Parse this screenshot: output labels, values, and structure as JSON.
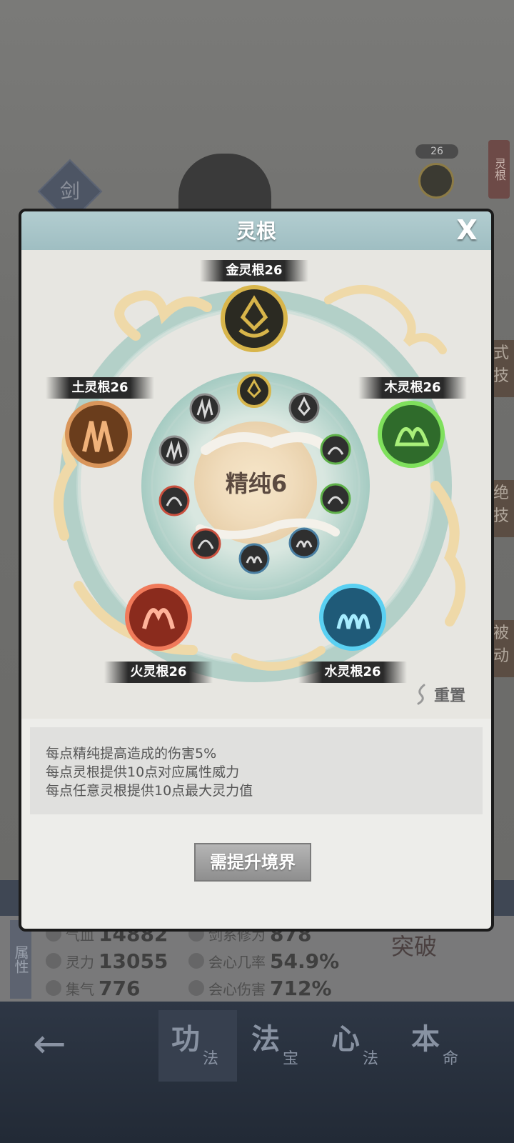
{
  "modal": {
    "title": "灵根",
    "close": "X",
    "center": "精纯6",
    "roots": {
      "metal": "金灵根26",
      "wood": "木灵根26",
      "earth": "土灵根26",
      "fire": "火灵根26",
      "water": "水灵根26"
    },
    "reset": "重置",
    "descriptions": [
      "每点精纯提高造成的伤害5%",
      "每点灵根提供10点对应属性威力",
      "每点任意灵根提供10点最大灵力值"
    ],
    "button": "需提升境界"
  },
  "background": {
    "sword_badge": "剑",
    "side_tab": "灵根",
    "mini_count": "26",
    "right_tabs": [
      "式技",
      "绝技",
      "被动"
    ]
  },
  "stats": {
    "section_label": "属性",
    "help": "?",
    "items": [
      {
        "label": "气血",
        "value": "14882"
      },
      {
        "label": "灵力",
        "value": "13055"
      },
      {
        "label": "集气",
        "value": "776"
      },
      {
        "label": "剑系修为",
        "value": "878"
      },
      {
        "label": "会心几率",
        "value": "54.9%"
      },
      {
        "label": "会心伤害",
        "value": "712%"
      }
    ],
    "breakthrough": "突破"
  },
  "nav": {
    "back": "←",
    "tabs": [
      {
        "big": "功",
        "small": "法"
      },
      {
        "big": "法",
        "small": "宝"
      },
      {
        "big": "心",
        "small": "法"
      },
      {
        "big": "本",
        "small": "命"
      }
    ]
  },
  "colors": {
    "metal": "#d8b54a",
    "wood": "#5fc23c",
    "earth": "#c98a4b",
    "fire": "#e0613a",
    "water": "#46b6d8",
    "ring": "#a8ccc3",
    "cloud": "#f1e3c2"
  }
}
